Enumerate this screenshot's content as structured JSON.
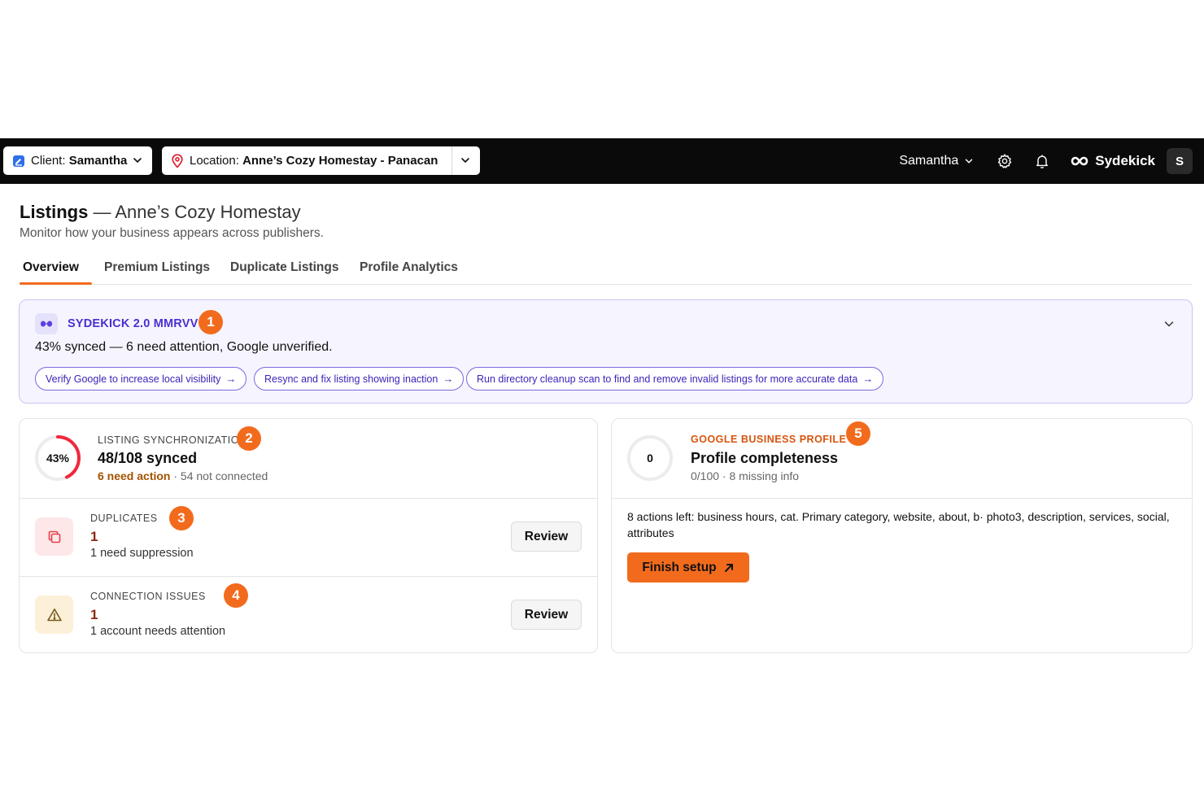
{
  "topbar": {
    "client_prefix": "Client:",
    "client_value": "Samantha",
    "location_prefix": "Location:",
    "location_value": "Anne’s Cozy Homestay - Panacan",
    "user_name": "Samantha",
    "brand_name": "Sydekick",
    "avatar_initial": "S"
  },
  "header": {
    "title_strong": "Listings",
    "title_rest": "— Anne’s Cozy Homestay",
    "subtitle": "Monitor how your business appears across publishers."
  },
  "tabs": [
    {
      "label": "Overview",
      "active": true
    },
    {
      "label": "Premium Listings",
      "active": false
    },
    {
      "label": "Duplicate Listings",
      "active": false
    },
    {
      "label": "Profile Analytics",
      "active": false
    }
  ],
  "banner": {
    "title": "SYDEKICK 2.0 MMRVV",
    "badge_number": "1",
    "summary": "43% synced — 6 need attention, Google unverified.",
    "chips": [
      {
        "label": "Verify Google to increase local visibility"
      },
      {
        "label": "Resync and fix listing showing inaction"
      },
      {
        "label": "Run directory cleanup scan to find and remove invalid listings for more accurate data"
      }
    ],
    "chip_arrow": "→"
  },
  "sync": {
    "ring_label": "43%",
    "percent": 43,
    "kicker": "LISTING SYNCHRONIZATION",
    "badge_number": "2",
    "headline": "48/108 synced",
    "need_action": "6 need action",
    "dot": "·",
    "not_connected": "54 not connected"
  },
  "duplicates": {
    "kicker": "DUPLICATES",
    "badge_number": "3",
    "count": "1",
    "desc": "1 need suppression",
    "button": "Review"
  },
  "connections": {
    "kicker": "CONNECTION ISSUES",
    "badge_number": "4",
    "count": "1",
    "desc": "1 account needs attention",
    "button": "Review"
  },
  "gbp": {
    "ring_label": "0",
    "score": 0,
    "kicker": "GOOGLE BUSINESS PROFILE",
    "badge_number": "5",
    "headline": "Profile completeness",
    "meta": "0/100 · 8 missing info",
    "actions": "8 actions left: business hours, cat. Primary category, website, about, b· photo3, description, services, social, attributes",
    "button": "Finish setup"
  },
  "colors": {
    "accent": "#f26b1d",
    "banner_purple": "#4a2fd0",
    "ring_red": "#f0283c",
    "warn_brown": "#a35200"
  },
  "icons": [
    "client-icon",
    "location-pin-icon",
    "chevron-down-icon",
    "gear-icon",
    "bell-icon",
    "infinity-logo-icon",
    "sydekick-badge-icon",
    "copy-icon",
    "warning-icon",
    "arrow-up-right-icon"
  ]
}
